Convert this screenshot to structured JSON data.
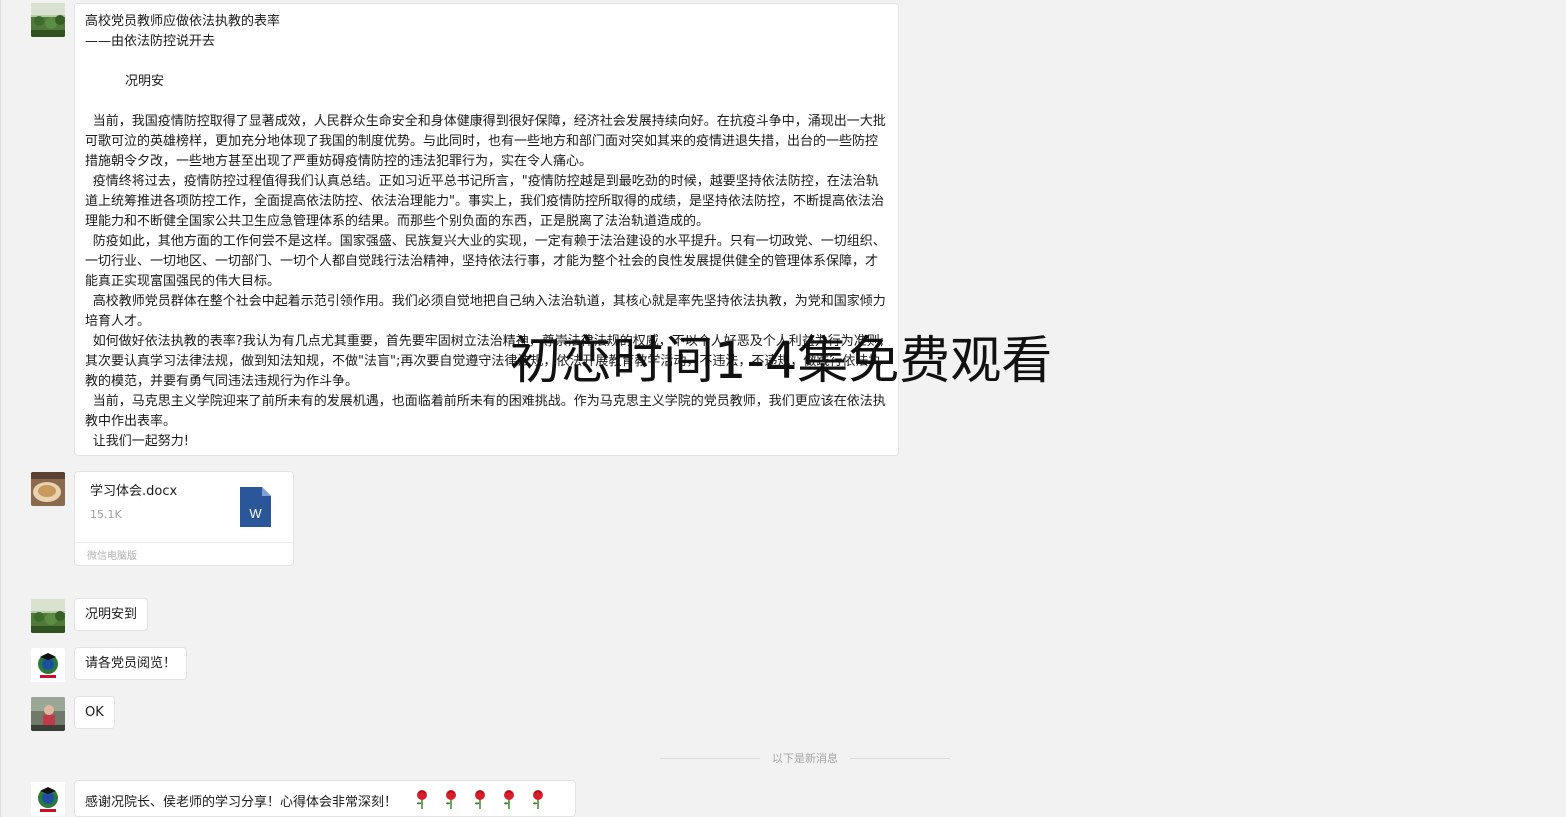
{
  "messages": {
    "article": {
      "title": "高校党员教师应做依法执教的表率",
      "subtitle": "——由依法防控说开去",
      "author": "况明安",
      "paragraphs": [
        "当前，我国疫情防控取得了显著成效，人民群众生命安全和身体健康得到很好保障，经济社会发展持续向好。在抗疫斗争中，涌现出一大批可歌可泣的英雄榜样，更加充分地体现了我国的制度优势。与此同时，也有一些地方和部门面对突如其来的疫情进退失措，出台的一些防控措施朝令夕改，一些地方甚至出现了严重妨碍疫情防控的违法犯罪行为，实在令人痛心。",
        "疫情终将过去，疫情防控过程值得我们认真总结。正如习近平总书记所言，\"疫情防控越是到最吃劲的时候，越要坚持依法防控，在法治轨道上统筹推进各项防控工作，全面提高依法防控、依法治理能力\"。事实上，我们疫情防控所取得的成绩，是坚持依法防控，不断提高依法治理能力和不断健全国家公共卫生应急管理体系的结果。而那些个别负面的东西，正是脱离了法治轨道造成的。",
        "防疫如此，其他方面的工作何尝不是这样。国家强盛、民族复兴大业的实现，一定有赖于法治建设的水平提升。只有一切政党、一切组织、一切行业、一切地区、一切部门、一切个人都自觉践行法治精神，坚持依法行事，才能为整个社会的良性发展提供健全的管理体系保障，才能真正实现富国强民的伟大目标。",
        "高校教师党员群体在整个社会中起着示范引领作用。我们必须自觉地把自己纳入法治轨道，其核心就是率先坚持依法执教，为党和国家倾力培育人才。",
        "如何做好依法执教的表率?我认为有几点尤其重要，首先要牢固树立法治精神，尊崇法律法规的权威，不以个人好恶及个人利益为行为准则;其次要认真学习法律法规，做到知法知规，不做\"法盲\";再次要自觉遵守法律法规，依法开展教育教学活动，不违法，不违规，做践行依法执教的模范，并要有勇气同违法违规行为作斗争。",
        "当前，马克思主义学院迎来了前所未有的发展机遇，也面临着前所未有的困难挑战。作为马克思主义学院的党员教师，我们更应该在依法执教中作出表率。",
        "让我们一起努力!"
      ]
    },
    "file": {
      "name": "学习体会.docx",
      "size": "15.1K",
      "source": "微信电脑版",
      "icon_letter": "W"
    },
    "msg1": "况明安到",
    "msg2": "请各党员阅览！",
    "msg3": "OK",
    "new_message_divider": "以下是新消息",
    "msg4": "感谢况院长、侯老师的学习分享！心得体会非常深刻！",
    "msg4_emoji": [
      "rose-icon",
      "rose-icon",
      "rose-icon",
      "rose-icon",
      "rose-icon"
    ]
  },
  "overlay_text": "初恋时间1-4集免费观看",
  "colors": {
    "background": "#f2f2f2",
    "bubble": "#ffffff",
    "word_blue": "#2b579a",
    "rose_red": "#d81e2c"
  }
}
